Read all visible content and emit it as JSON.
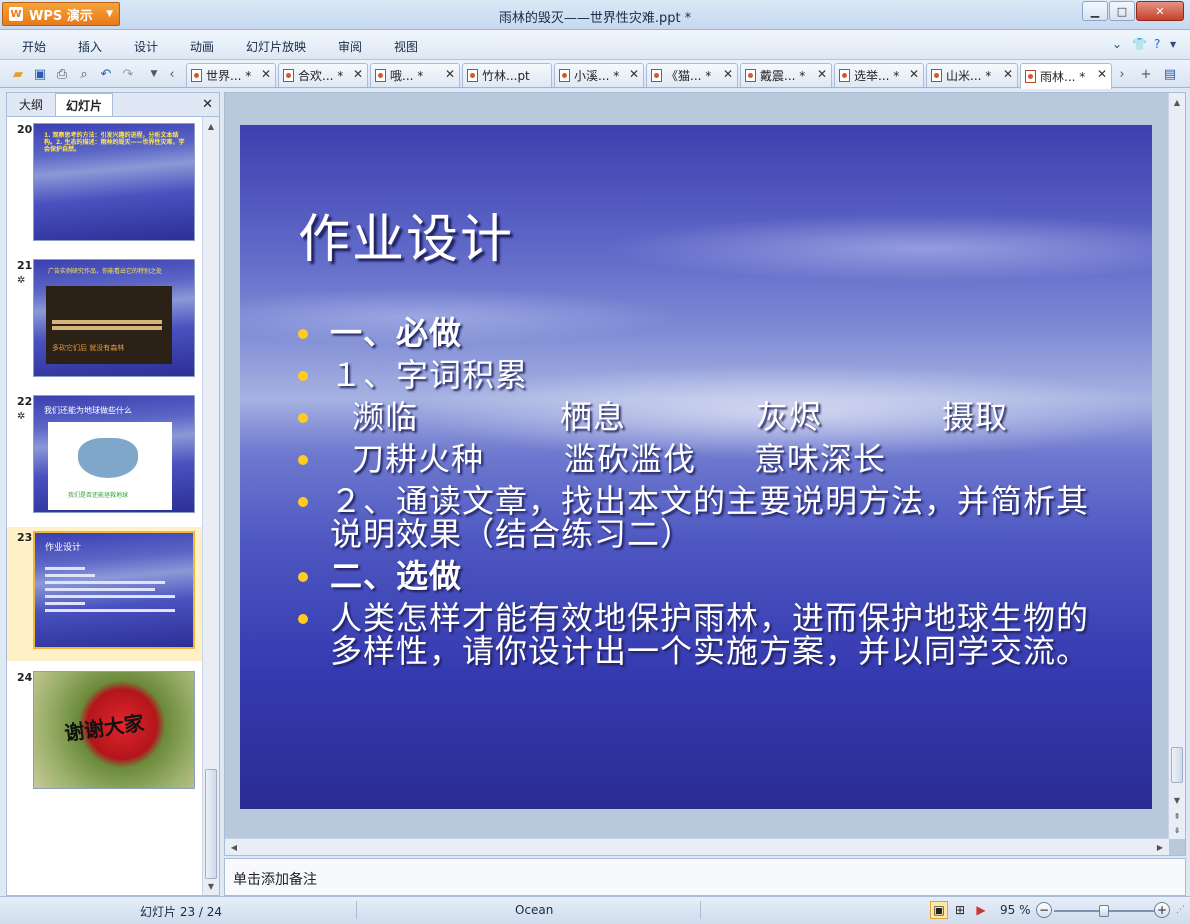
{
  "app": {
    "button_label": "WPS 演示",
    "window_title": "雨林的毁灭——世界性灾难.ppt *"
  },
  "window_controls": {
    "minimize": "▁",
    "maximize": "□",
    "close": "✕"
  },
  "menu": {
    "items": [
      "开始",
      "插入",
      "设计",
      "动画",
      "幻灯片放映",
      "审阅",
      "视图"
    ],
    "right_icons": [
      "chevron-down-icon",
      "shirt-icon",
      "help-icon"
    ]
  },
  "toolbar": {
    "icons": [
      "open-icon",
      "save-icon",
      "print-icon",
      "print-preview-icon",
      "undo-icon",
      "redo-icon",
      "dropdown-icon",
      "tab-scroll-left-icon"
    ]
  },
  "doc_tabs": [
    {
      "label": "世界... *"
    },
    {
      "label": "合欢... *"
    },
    {
      "label": "哦... *"
    },
    {
      "label": "竹林...pt"
    },
    {
      "label": "小溪... *"
    },
    {
      "label": "《猫... *"
    },
    {
      "label": "戴震... *"
    },
    {
      "label": "选举... *"
    },
    {
      "label": "山米... *"
    },
    {
      "label": "雨林... *"
    }
  ],
  "left_panel": {
    "tab_outline": "大纲",
    "tab_slides": "幻灯片",
    "close": "✕",
    "thumbnails": [
      {
        "num": "20",
        "star": "",
        "text": "1. 观察思考的方法：引发兴趣的进程，分析文本结构。2. 生态的描述：雨林的毁灭——世界性灾难，学会保护自然。"
      },
      {
        "num": "21",
        "star": "✲",
        "text": "广告实例研究作品，你能看出它的特别之处",
        "caption": "多砍它们后 就没有森林"
      },
      {
        "num": "22",
        "star": "✲",
        "text": "我们还能为地球做些什么",
        "caption": "我们是否还能拯救地球"
      },
      {
        "num": "23",
        "star": "",
        "text": "作业设计"
      },
      {
        "num": "24",
        "star": "",
        "text": "谢谢大家"
      }
    ]
  },
  "slide": {
    "title": "作业设计",
    "bullets": {
      "b1": "一、必做",
      "b2": "１、字词积累",
      "b3": [
        "濒临",
        "栖息",
        "灰烬",
        "摄取"
      ],
      "b4": [
        "刀耕火种",
        "滥砍滥伐",
        "意味深长"
      ],
      "b5": "２、通读文章，找出本文的主要说明方法，并简析其说明效果（结合练习二）",
      "b6": "二、选做",
      "b7": "人类怎样才能有效地保护雨林，进而保护地球生物的多样性，请你设计出一个实施方案，并以同学交流。"
    }
  },
  "notes": {
    "placeholder": "单击添加备注"
  },
  "status": {
    "slide_counter": "幻灯片 23 / 24",
    "theme": "Ocean",
    "zoom": "95 %",
    "zoom_fraction": 0.5
  },
  "colors": {
    "accent": "#ffcc1e",
    "slide_base": "#353ab0",
    "selection": "#f1b73a"
  }
}
